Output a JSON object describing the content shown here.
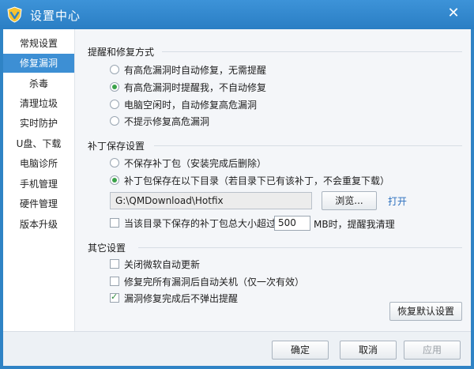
{
  "window": {
    "title": "设置中心",
    "close_glyph": "✕"
  },
  "sidebar": {
    "items": [
      {
        "label": "常规设置",
        "active": false
      },
      {
        "label": "修复漏洞",
        "active": true
      },
      {
        "label": "杀毒",
        "active": false
      },
      {
        "label": "清理垃圾",
        "active": false
      },
      {
        "label": "实时防护",
        "active": false
      },
      {
        "label": "U盘、下载",
        "active": false
      },
      {
        "label": "电脑诊所",
        "active": false
      },
      {
        "label": "手机管理",
        "active": false
      },
      {
        "label": "硬件管理",
        "active": false
      },
      {
        "label": "版本升级",
        "active": false
      }
    ]
  },
  "repair": {
    "title": "提醒和修复方式",
    "options": [
      {
        "label": "有高危漏洞时自动修复，无需提醒",
        "checked": false
      },
      {
        "label": "有高危漏洞时提醒我，不自动修复",
        "checked": true
      },
      {
        "label": "电脑空闲时，自动修复高危漏洞",
        "checked": false
      },
      {
        "label": "不提示修复高危漏洞",
        "checked": false
      }
    ]
  },
  "patch": {
    "title": "补丁保存设置",
    "options": [
      {
        "label": "不保存补丁包（安装完成后删除）",
        "checked": false
      },
      {
        "label": "补丁包保存在以下目录（若目录下已有该补丁，不会重复下载）",
        "checked": true
      }
    ],
    "path_value": "G:\\QMDownload\\Hotfix",
    "browse_label": "浏览...",
    "open_label": "打开",
    "size_prefix": "当该目录下保存的补丁包总大小超过",
    "size_value": "500",
    "size_suffix": "MB时，提醒我清理",
    "size_checked": false
  },
  "other": {
    "title": "其它设置",
    "options": [
      {
        "label": "关闭微软自动更新",
        "checked": false
      },
      {
        "label": "修复完所有漏洞后自动关机（仅一次有效）",
        "checked": false
      },
      {
        "label": "漏洞修复完成后不弹出提醒",
        "checked": true
      }
    ],
    "restore_label": "恢复默认设置"
  },
  "footer": {
    "ok_label": "确定",
    "cancel_label": "取消",
    "apply_label": "应用"
  },
  "colors": {
    "titlebar": "#2f83c5",
    "active_nav": "#3d8fd4",
    "radio_checked": "#3ba24a",
    "link": "#2b6fbe"
  }
}
